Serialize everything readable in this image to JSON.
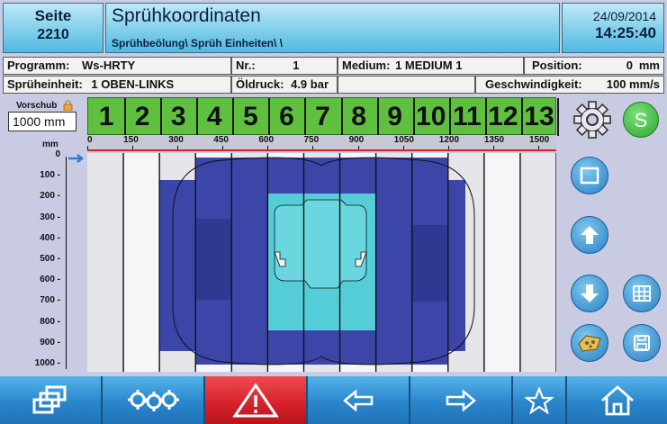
{
  "header": {
    "page_label": "Seite",
    "page_number": "2210",
    "title": "Sprühkoordinaten",
    "subtitle": "Sprühbeölung\\ Sprüh Einheiten\\ \\",
    "date": "24/09/2014",
    "time": "14:25:40"
  },
  "info_row1": {
    "programm_label": "Programm:",
    "programm_value": "Ws-HRTY",
    "nr_label": "Nr.:",
    "nr_value": "1",
    "medium_label": "Medium:",
    "medium_value": "1  MEDIUM 1",
    "position_label": "Position:",
    "position_value": "0",
    "position_unit": "mm"
  },
  "info_row2": {
    "einheit_label": "Sprüheinheit:",
    "einheit_value": "1  OBEN-LINKS",
    "oeldruck_label": "Öldruck:",
    "oeldruck_value": "4.9 bar",
    "speed_label": "Geschwindigkeit:",
    "speed_value": "100 mm/s"
  },
  "vorschub": {
    "label": "Vorschub",
    "value": "1000 mm"
  },
  "columns": [
    "1",
    "2",
    "3",
    "4",
    "5",
    "6",
    "7",
    "8",
    "9",
    "10",
    "11",
    "12",
    "13"
  ],
  "x_axis": {
    "unit": "mm",
    "ticks": [
      "0",
      "150",
      "300",
      "450",
      "600",
      "750",
      "900",
      "1050",
      "1200",
      "1350",
      "1500"
    ]
  },
  "y_axis": {
    "ticks": [
      "0",
      "100",
      "200",
      "300",
      "400",
      "500",
      "600",
      "700",
      "800",
      "900",
      "1000"
    ]
  },
  "right_buttons": {
    "settings_icon": "gear-icon",
    "s_label": "S",
    "square_icon": "square-icon",
    "up_icon": "arrow-up-icon",
    "down_icon": "arrow-down-icon",
    "grid_icon": "grid-icon",
    "part_icon": "part-icon",
    "save_icon": "floppy-icon"
  },
  "bottom_nav": [
    {
      "icon": "windows-icon"
    },
    {
      "icon": "gears-icon"
    },
    {
      "icon": "warning-icon"
    },
    {
      "icon": "arrow-left-icon"
    },
    {
      "icon": "arrow-right-icon"
    },
    {
      "icon": "star-icon"
    },
    {
      "icon": "home-icon"
    }
  ],
  "colors": {
    "accent": "#2d8bd3",
    "alarm": "#d4202a",
    "column_green": "#5fc040",
    "dark_blue": "#3b46a8",
    "light_cyan": "#55cdd8"
  }
}
